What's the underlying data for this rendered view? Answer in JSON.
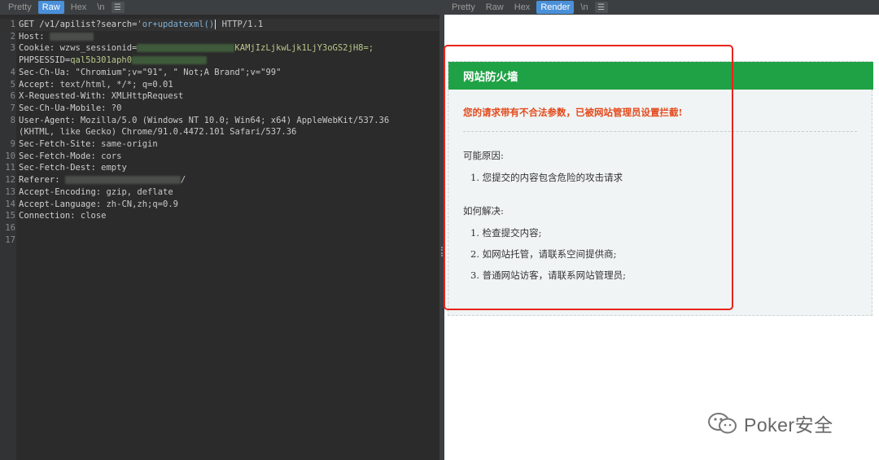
{
  "left_tabs": [
    {
      "label": "Pretty",
      "active": false
    },
    {
      "label": "Raw",
      "active": true
    },
    {
      "label": "Hex",
      "active": false
    },
    {
      "label": "\\n",
      "active": false
    }
  ],
  "right_tabs": [
    {
      "label": "Pretty",
      "active": false
    },
    {
      "label": "Raw",
      "active": false
    },
    {
      "label": "Hex",
      "active": false
    },
    {
      "label": "Render",
      "active": true
    },
    {
      "label": "\\n",
      "active": false
    }
  ],
  "request_lines": [
    {
      "num": "1",
      "name": "GET /v1/apilist?search=",
      "value": "'or+updatexml()",
      "tail": "HTTP/1.1"
    },
    {
      "num": "2",
      "name": "Host:",
      "value": ""
    },
    {
      "num": "3",
      "name": "Cookie:",
      "value": "wzws_sessionid=",
      "tail": "KAMjIzLjkwLjk1LjY3oGS2jH8=;"
    },
    {
      "num": "",
      "name": "PHPSESSID=",
      "value": "qal5b301aph0"
    },
    {
      "num": "4",
      "name": "Sec-Ch-Ua:",
      "value": "\"Chromium\";v=\"91\", \" Not;A Brand\";v=\"99\""
    },
    {
      "num": "5",
      "name": "Accept:",
      "value": "text/html, */*; q=0.01"
    },
    {
      "num": "6",
      "name": "X-Requested-With:",
      "value": "XMLHttpRequest"
    },
    {
      "num": "7",
      "name": "Sec-Ch-Ua-Mobile:",
      "value": "?0"
    },
    {
      "num": "8",
      "name": "User-Agent:",
      "value": "Mozilla/5.0 (Windows NT 10.0; Win64; x64) AppleWebKit/537.36"
    },
    {
      "num": "",
      "name": "",
      "value": "(KHTML, like Gecko) Chrome/91.0.4472.101 Safari/537.36"
    },
    {
      "num": "9",
      "name": "Sec-Fetch-Site:",
      "value": "same-origin"
    },
    {
      "num": "10",
      "name": "Sec-Fetch-Mode:",
      "value": "cors"
    },
    {
      "num": "11",
      "name": "Sec-Fetch-Dest:",
      "value": "empty"
    },
    {
      "num": "12",
      "name": "Referer:",
      "value": "",
      "tail": "/"
    },
    {
      "num": "13",
      "name": "Accept-Encoding:",
      "value": "gzip, deflate"
    },
    {
      "num": "14",
      "name": "Accept-Language:",
      "value": "zh-CN,zh;q=0.9"
    },
    {
      "num": "15",
      "name": "Connection:",
      "value": "close"
    },
    {
      "num": "16",
      "name": "",
      "value": ""
    },
    {
      "num": "17",
      "name": "",
      "value": ""
    }
  ],
  "firewall": {
    "title": "网站防火墙",
    "message": "您的请求带有不合法参数，已被网站管理员设置拦截!",
    "reasons_heading": "可能原因:",
    "reasons": [
      "1. 您提交的内容包含危险的攻击请求"
    ],
    "solutions_heading": "如何解决:",
    "solutions": [
      "1. 检查提交内容;",
      "2. 如网站托管，请联系空间提供商;",
      "3. 普通网站访客，请联系网站管理员;"
    ]
  },
  "watermark": {
    "text": "Poker安全",
    "icon": "wechat-icon"
  },
  "colors": {
    "accent": "#4a90d9",
    "firewall_green": "#1fa245",
    "alert_red": "#e34a1c",
    "annotation_red": "#e8241c"
  }
}
